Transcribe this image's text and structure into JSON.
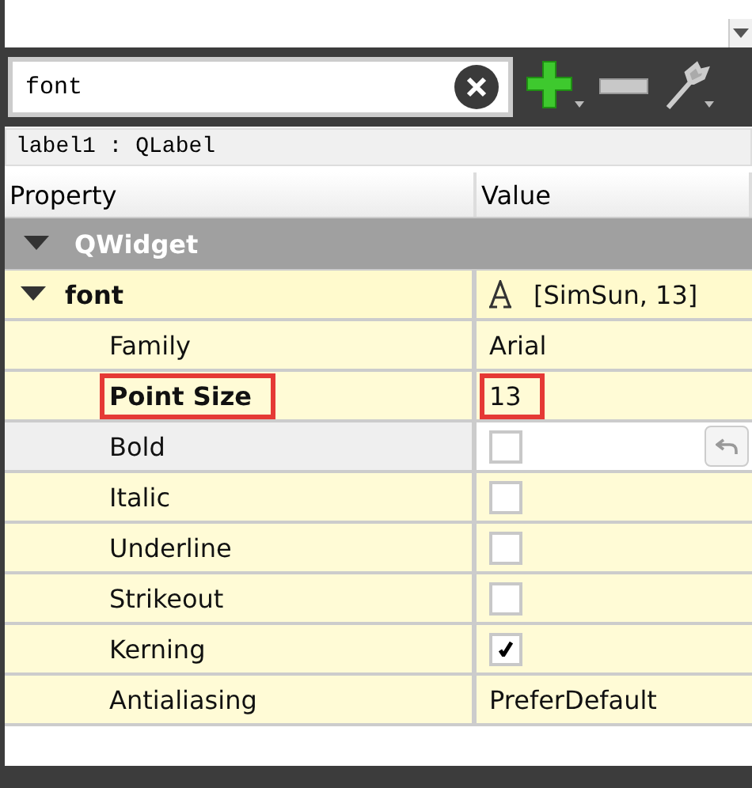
{
  "search": {
    "value": "font"
  },
  "object_label": "label1 : QLabel",
  "header": [
    "Property",
    "Value"
  ],
  "groups": [
    {
      "name": "QWidget",
      "expanded": true,
      "children": [
        {
          "name": "font",
          "kind": "text",
          "value": "[SimSun, 13]",
          "expanded": true,
          "modified": true,
          "selected": false,
          "highlighted": false,
          "children": [
            {
              "name": "Family",
              "kind": "text",
              "value": "Arial",
              "modified": false,
              "selected": false,
              "highlighted": false
            },
            {
              "name": "Point Size",
              "kind": "text",
              "value": "13",
              "modified": true,
              "selected": false,
              "highlighted": true
            },
            {
              "name": "Bold",
              "kind": "checkbox",
              "checked": false,
              "modified": false,
              "selected": true,
              "highlighted": false
            },
            {
              "name": "Italic",
              "kind": "checkbox",
              "checked": false,
              "modified": false,
              "selected": false,
              "highlighted": false
            },
            {
              "name": "Underline",
              "kind": "checkbox",
              "checked": false,
              "modified": false,
              "selected": false,
              "highlighted": false
            },
            {
              "name": "Strikeout",
              "kind": "checkbox",
              "checked": false,
              "modified": false,
              "selected": false,
              "highlighted": false
            },
            {
              "name": "Kerning",
              "kind": "checkbox",
              "checked": true,
              "modified": false,
              "selected": false,
              "highlighted": false
            },
            {
              "name": "Antialiasing",
              "kind": "text",
              "value": "PreferDefault",
              "modified": false,
              "selected": false,
              "highlighted": false
            }
          ]
        }
      ]
    }
  ]
}
